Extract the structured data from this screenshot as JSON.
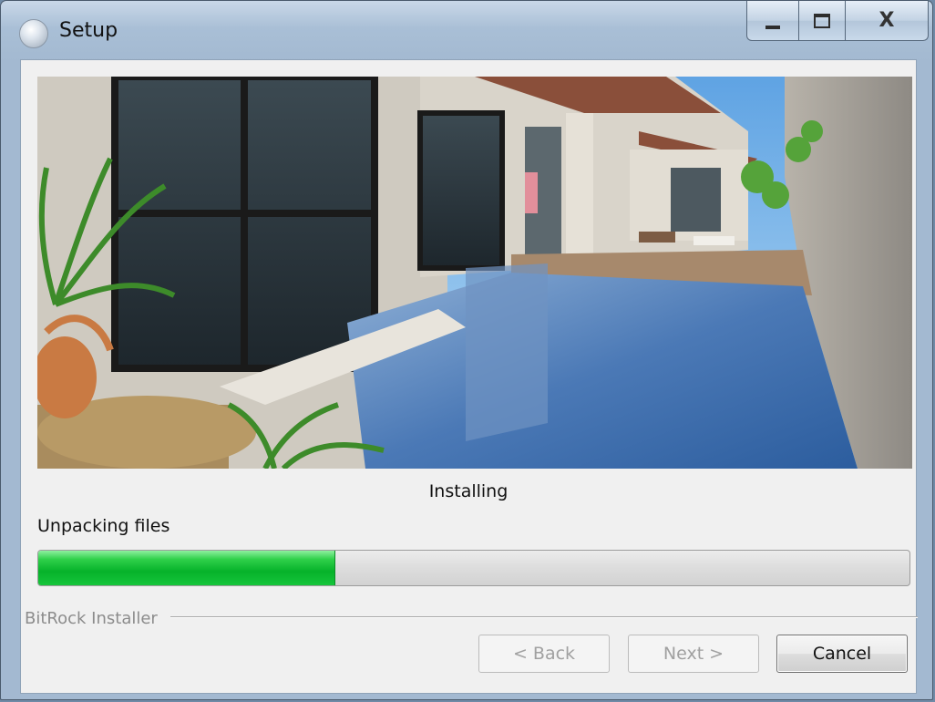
{
  "window": {
    "title": "Setup",
    "close_glyph": "X"
  },
  "installer": {
    "heading": "Installing",
    "status": "Unpacking files",
    "progress_fraction": 0.34,
    "group_label": "BitRock Installer"
  },
  "buttons": {
    "back": "< Back",
    "next": "Next >",
    "cancel": "Cancel"
  },
  "icons": {
    "app": "setup-gear-icon",
    "minimize": "minimize-icon",
    "maximize": "maximize-icon",
    "close": "close-icon"
  },
  "colors": {
    "progress": "#09b62e",
    "window_frame": "#a9bfd6"
  }
}
